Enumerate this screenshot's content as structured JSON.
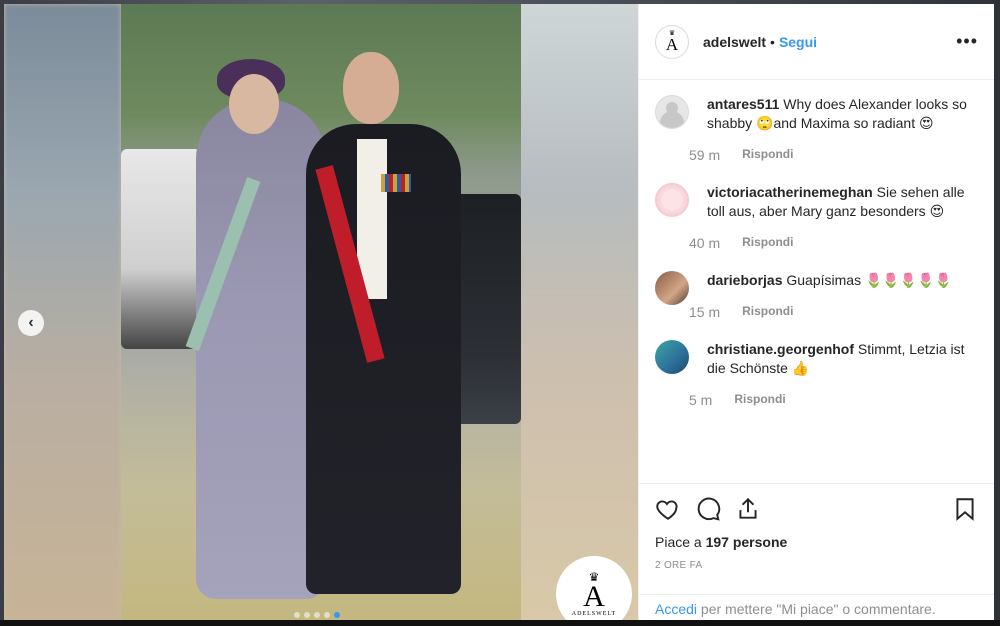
{
  "post": {
    "account": "adelswelt",
    "separator": "•",
    "follow_label": "Segui",
    "more_label": "•••",
    "logo_letter": "A",
    "logo_word": "ADELSWELT"
  },
  "carousel": {
    "prev_symbol": "‹",
    "dot_count": 5,
    "active_dot": 4
  },
  "comments": [
    {
      "user": "antares511",
      "text": "Why does Alexander looks so shabby 🙄and Maxima so radiant 😍",
      "time": "59 m",
      "reply": "Rispondi",
      "avatar": "grey"
    },
    {
      "user": "victoriacatherinemeghan",
      "text": "Sie sehen alle toll aus, aber Mary ganz besonders 😍",
      "time": "40 m",
      "reply": "Rispondi",
      "avatar": "pink"
    },
    {
      "user": "darieborjas",
      "text": "Guapísimas 🌷🌷🌷🌷🌷",
      "time": "15 m",
      "reply": "Rispondi",
      "avatar": "photo1"
    },
    {
      "user": "christiane.georgenhof",
      "text": "Stimmt, Letzia ist die Schönste 👍",
      "time": "5 m",
      "reply": "Rispondi",
      "avatar": "photo2"
    }
  ],
  "actions": {
    "likes_prefix": "Piace a ",
    "likes_count": "197 persone",
    "posted_ago": "2 ORE FA"
  },
  "login": {
    "link_label": "Accedi",
    "rest_text": " per mettere \"Mi piace\" o commentare."
  },
  "icons": [
    "heart-icon",
    "comment-icon",
    "share-icon",
    "bookmark-icon",
    "chevron-left-icon",
    "crown-logo-icon"
  ]
}
